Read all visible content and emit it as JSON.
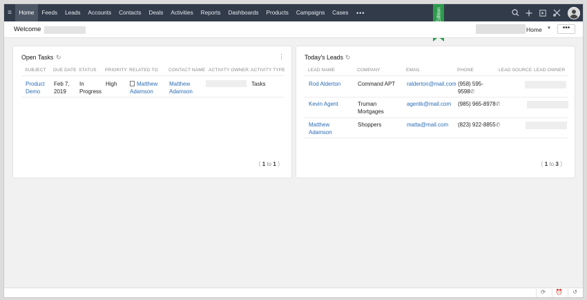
{
  "nav": {
    "tabs": [
      "Home",
      "Feeds",
      "Leads",
      "Accounts",
      "Contacts",
      "Deals",
      "Activities",
      "Reports",
      "Dashboards",
      "Products",
      "Campaigns",
      "Cases"
    ],
    "active": "Home",
    "more": "•••"
  },
  "ribbon": "Dev Edition",
  "welcome": {
    "label": "Welcome",
    "home_select": "Home",
    "more_button": "•••"
  },
  "open_tasks": {
    "title": "Open Tasks",
    "columns": [
      "SUBJECT",
      "DUE DATE",
      "STATUS",
      "PRIORITY",
      "RELATED TO",
      "CONTACT NAME",
      "ACTIVITY OWNER",
      "ACTIVITY TYPE"
    ],
    "rows": [
      {
        "subject_1": "Product",
        "subject_2": "Demo",
        "due_1": "Feb 7,",
        "due_2": "2019",
        "status_1": "In",
        "status_2": "Progress",
        "priority": "High",
        "related_1": "Matthew",
        "related_2": "Adamson",
        "contact_1": "Matthew",
        "contact_2": "Adamson",
        "activity_type": "Tasks"
      }
    ],
    "pager": {
      "from": "1",
      "to_label": "to",
      "to": "1"
    }
  },
  "todays_leads": {
    "title": "Today's Leads",
    "columns": [
      "LEAD NAME",
      "COMPANY",
      "EMAIL",
      "PHONE",
      "LEAD SOURCE",
      "LEAD OWNER"
    ],
    "rows": [
      {
        "name_1": "Rod Alderton",
        "name_2": "",
        "company_1": "Command APT",
        "company_2": "",
        "email": "ralderton@mail.com",
        "phone_1": "(958) 595-",
        "phone_2": "9598"
      },
      {
        "name_1": "Kevin Agent",
        "name_2": "",
        "company_1": "Truman",
        "company_2": "Mortgages",
        "email": "agentk@mail.com",
        "phone_1": "(985) 965-8978",
        "phone_2": ""
      },
      {
        "name_1": "Matthew",
        "name_2": "Adamson",
        "company_1": "Shoppers",
        "company_2": "",
        "email": "matta@mail.com",
        "phone_1": "(823) 922-8855",
        "phone_2": ""
      }
    ],
    "pager": {
      "from": "1",
      "to_label": "to",
      "to": "3"
    }
  },
  "colors": {
    "nav_bg": "#313b4a",
    "nav_active": "#4d5665",
    "link": "#2a6cb5",
    "ribbon": "#2e9a4e"
  },
  "icons": [
    "hamburger-icon",
    "search-icon",
    "add-icon",
    "feedback-icon",
    "tools-icon",
    "refresh-icon",
    "kebab-icon",
    "phone-icon",
    "document-icon",
    "sync-icon",
    "alarm-icon",
    "history-icon"
  ]
}
